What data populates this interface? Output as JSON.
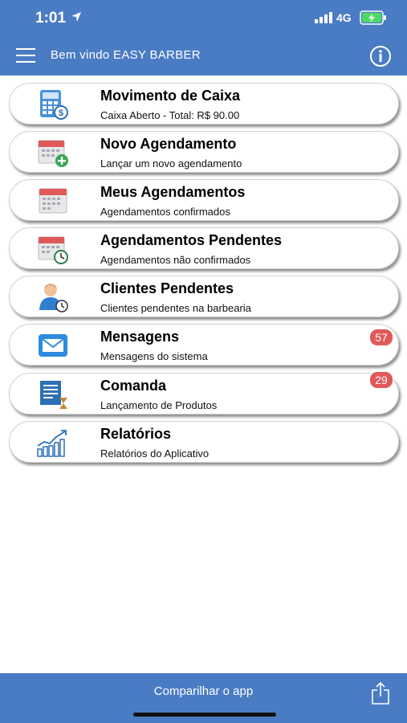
{
  "status_bar": {
    "time": "1:01",
    "network": "4G"
  },
  "header": {
    "title": "Bem vindo EASY BARBER"
  },
  "menu": [
    {
      "title": "Movimento de Caixa",
      "subtitle": "Caixa Aberto - Total: R$ 90.00",
      "icon": "calculator-icon"
    },
    {
      "title": "Novo Agendamento",
      "subtitle": "Lançar um novo agendamento",
      "icon": "calendar-add-icon"
    },
    {
      "title": "Meus Agendamentos",
      "subtitle": "Agendamentos confirmados",
      "icon": "calendar-icon"
    },
    {
      "title": "Agendamentos Pendentes",
      "subtitle": "Agendamentos não confirmados",
      "icon": "calendar-clock-icon"
    },
    {
      "title": "Clientes Pendentes",
      "subtitle": "Clientes pendentes na barbearia",
      "icon": "user-clock-icon"
    },
    {
      "title": "Mensagens",
      "subtitle": "Mensagens do sistema",
      "icon": "envelope-icon",
      "badge": "57"
    },
    {
      "title": "Comanda",
      "subtitle": "Lançamento de Produtos",
      "icon": "order-slip-icon",
      "badge": "29"
    },
    {
      "title": "Relatórios",
      "subtitle": "Relatórios do Aplicativo",
      "icon": "chart-icon"
    }
  ],
  "footer": {
    "share_label": "Comparilhar o app"
  },
  "colors": {
    "primary": "#4a7cc4",
    "badge": "#e05a5a"
  }
}
